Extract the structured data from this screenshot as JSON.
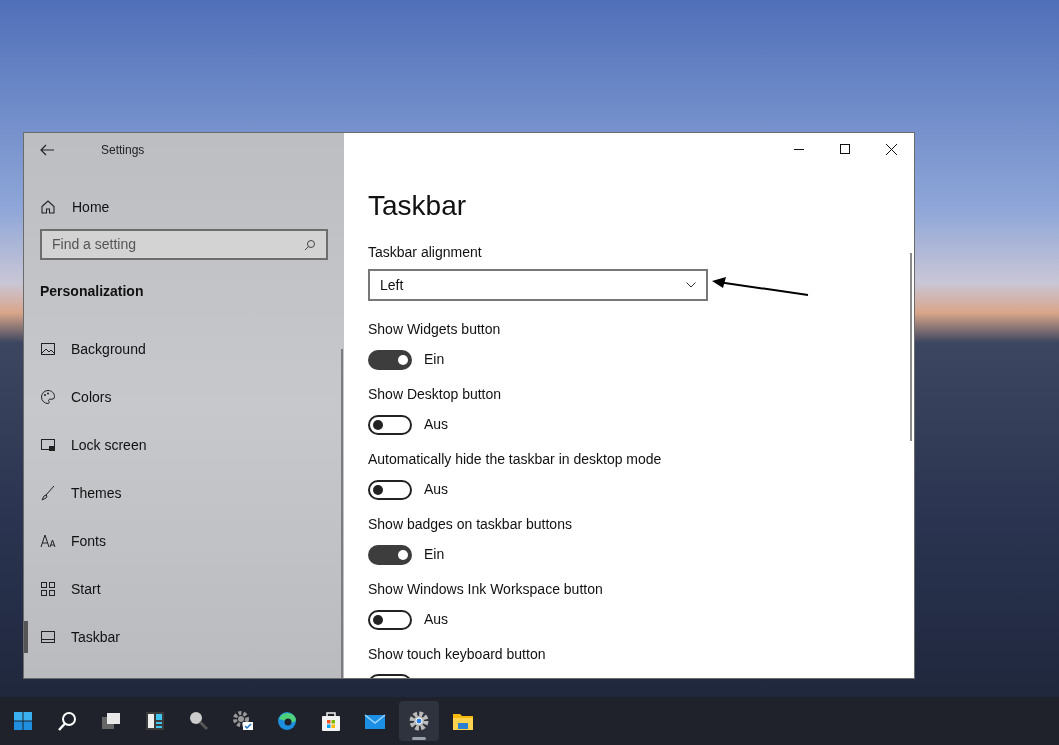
{
  "window": {
    "title": "Settings"
  },
  "sidebar": {
    "home": "Home",
    "search": {
      "placeholder": "Find a setting"
    },
    "section": "Personalization",
    "items": [
      {
        "label": "Background",
        "kind": "picture",
        "selected": false
      },
      {
        "label": "Colors",
        "kind": "palette",
        "selected": false
      },
      {
        "label": "Lock screen",
        "kind": "lock",
        "selected": false
      },
      {
        "label": "Themes",
        "kind": "brush",
        "selected": false
      },
      {
        "label": "Fonts",
        "kind": "font",
        "selected": false
      },
      {
        "label": "Start",
        "kind": "start",
        "selected": false
      },
      {
        "label": "Taskbar",
        "kind": "taskbar",
        "selected": true
      }
    ]
  },
  "page": {
    "title": "Taskbar",
    "alignment": {
      "label": "Taskbar alignment",
      "value": "Left"
    },
    "settings": [
      {
        "label": "Show Widgets button",
        "on": true,
        "state": "Ein"
      },
      {
        "label": "Show Desktop button",
        "on": false,
        "state": "Aus"
      },
      {
        "label": "Automatically hide the taskbar in desktop mode",
        "on": false,
        "state": "Aus"
      },
      {
        "label": "Show badges on taskbar buttons",
        "on": true,
        "state": "Ein"
      },
      {
        "label": "Show Windows Ink Workspace button",
        "on": false,
        "state": "Aus"
      },
      {
        "label": "Show touch keyboard button",
        "on": false
      }
    ]
  },
  "taskbar": [
    {
      "kind": "start",
      "active": false
    },
    {
      "kind": "search",
      "active": false
    },
    {
      "kind": "taskview",
      "active": false
    },
    {
      "kind": "widgets",
      "active": false
    },
    {
      "kind": "magnifier",
      "active": false
    },
    {
      "kind": "gearcheck",
      "active": false
    },
    {
      "kind": "browser",
      "active": false
    },
    {
      "kind": "store",
      "active": false
    },
    {
      "kind": "mail",
      "active": false
    },
    {
      "kind": "settings",
      "active": true
    },
    {
      "kind": "folder",
      "active": false
    }
  ]
}
